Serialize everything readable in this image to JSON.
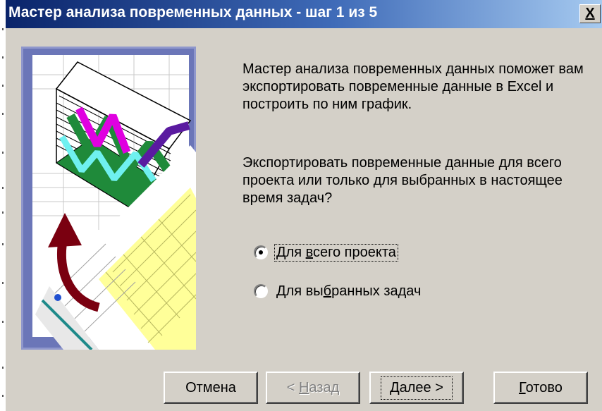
{
  "window": {
    "title": "Мастер анализа повременных данных - шаг 1 из 5",
    "close_label": "X"
  },
  "content": {
    "intro": "Мастер анализа повременных данных поможет вам экспортировать повременные данные в Excel и построить по ним график.",
    "question": "Экспортировать повременные данные для всего проекта или только для выбранных в настоящее время задач?"
  },
  "options": [
    {
      "pre": "Для ",
      "key": "в",
      "post": "сего проекта",
      "selected": true
    },
    {
      "pre": "Для вы",
      "key": "б",
      "post": "ранных задач",
      "selected": false
    }
  ],
  "buttons": {
    "cancel": "Отмена",
    "back": {
      "pre": "< ",
      "key": "Н",
      "post": "азад"
    },
    "next": {
      "key": "Д",
      "post": "алее >"
    },
    "finish": {
      "key": "Г",
      "post": "отово"
    }
  },
  "colors": {
    "title_bar_start": "#0a246a",
    "title_bar_end": "#a6caf0",
    "dialog_face": "#d4d0c8",
    "illustration_bg": "#6b76b8",
    "chart_magenta": "#e000e0",
    "chart_green": "#1f8a3a",
    "chart_cyan": "#6ff0f0",
    "chart_purple": "#5a1aa0",
    "arrow_red": "#7a0010",
    "grid_yellow": "#ffff99"
  }
}
